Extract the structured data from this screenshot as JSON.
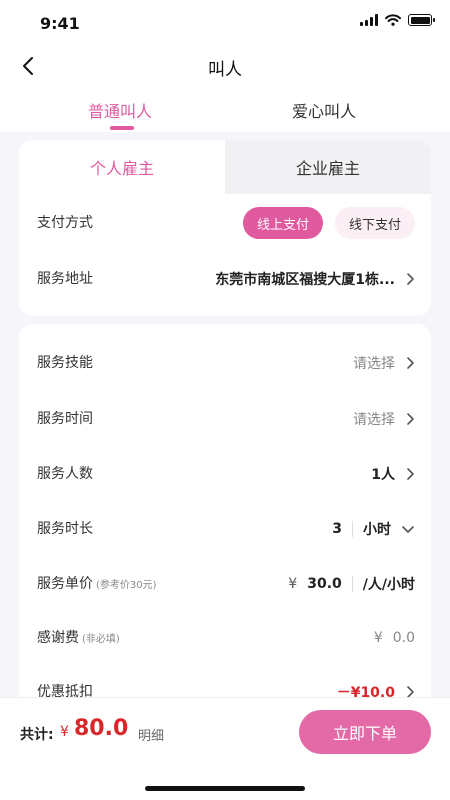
{
  "status_bar": {
    "time": "9:41"
  },
  "nav": {
    "title": "叫人"
  },
  "top_tabs": [
    {
      "label": "普通叫人",
      "active": true
    },
    {
      "label": "爱心叫人",
      "active": false
    }
  ],
  "employer_tabs": [
    {
      "label": "个人雇主",
      "active": true
    },
    {
      "label": "企业雇主",
      "active": false
    }
  ],
  "payment": {
    "label": "支付方式",
    "online": "线上支付",
    "offline": "线下支付",
    "selected": "online"
  },
  "address": {
    "label": "服务地址",
    "value": "东莞市南城区福搜大厦1栋..."
  },
  "form": {
    "skill": {
      "label": "服务技能",
      "placeholder": "请选择"
    },
    "time": {
      "label": "服务时间",
      "placeholder": "请选择"
    },
    "headcount": {
      "label": "服务人数",
      "value": "1人"
    },
    "duration": {
      "label": "服务时长",
      "value": "3",
      "unit": "小时"
    },
    "price": {
      "label": "服务单价",
      "hint": "(参考价30元)",
      "currency": "¥",
      "value": "30.0",
      "unit": "/人/小时"
    },
    "tip": {
      "label": "感谢费",
      "hint": "(非必填)",
      "currency": "¥",
      "placeholder": "0.0"
    },
    "discount": {
      "label": "优惠抵扣",
      "value": "－¥10.0"
    }
  },
  "bottom": {
    "total_label": "共计:",
    "currency": "¥",
    "total": "80.0",
    "detail": "明细",
    "submit": "立即下单"
  },
  "colors": {
    "accent": "#e05aa0",
    "price_red": "#d9262b",
    "background": "#f6f6fa"
  }
}
